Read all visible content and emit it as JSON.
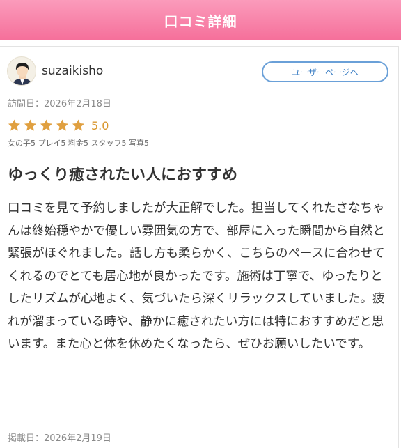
{
  "header": {
    "title": "口コミ詳細"
  },
  "review": {
    "username": "suzaikisho",
    "user_page_button": "ユーザーページへ",
    "visit_date": "訪問日：2026年2月18日",
    "stars_filled": 5,
    "rating": "5.0",
    "subscores": "女の子5 プレイ5 料金5 スタッフ5 写真5",
    "title": "ゆっくり癒されたい人におすすめ",
    "body": "口コミを見て予約しましたが大正解でした。担当してくれたさなちゃんは終始穏やかで優しい雰囲気の方で、部屋に入った瞬間から自然と緊張がほぐれました。話し方も柔らかく、こちらのペースに合わせてくれるのでとても居心地が良かったです。施術は丁寧で、ゆったりとしたリズムが心地よく、気づいたら深くリラックスしていました。疲れが溜まっている時や、静かに癒されたい方には特におすすめだと思います。また心と体を休めたくなったら、ぜひお願いしたいです。",
    "posted_date": "掲載日：2026年2月19日"
  },
  "colors": {
    "header_top": "#fb9bbb",
    "header_bottom": "#f56f9a",
    "star": "#e0a040",
    "button_border": "#6aa0d8"
  }
}
